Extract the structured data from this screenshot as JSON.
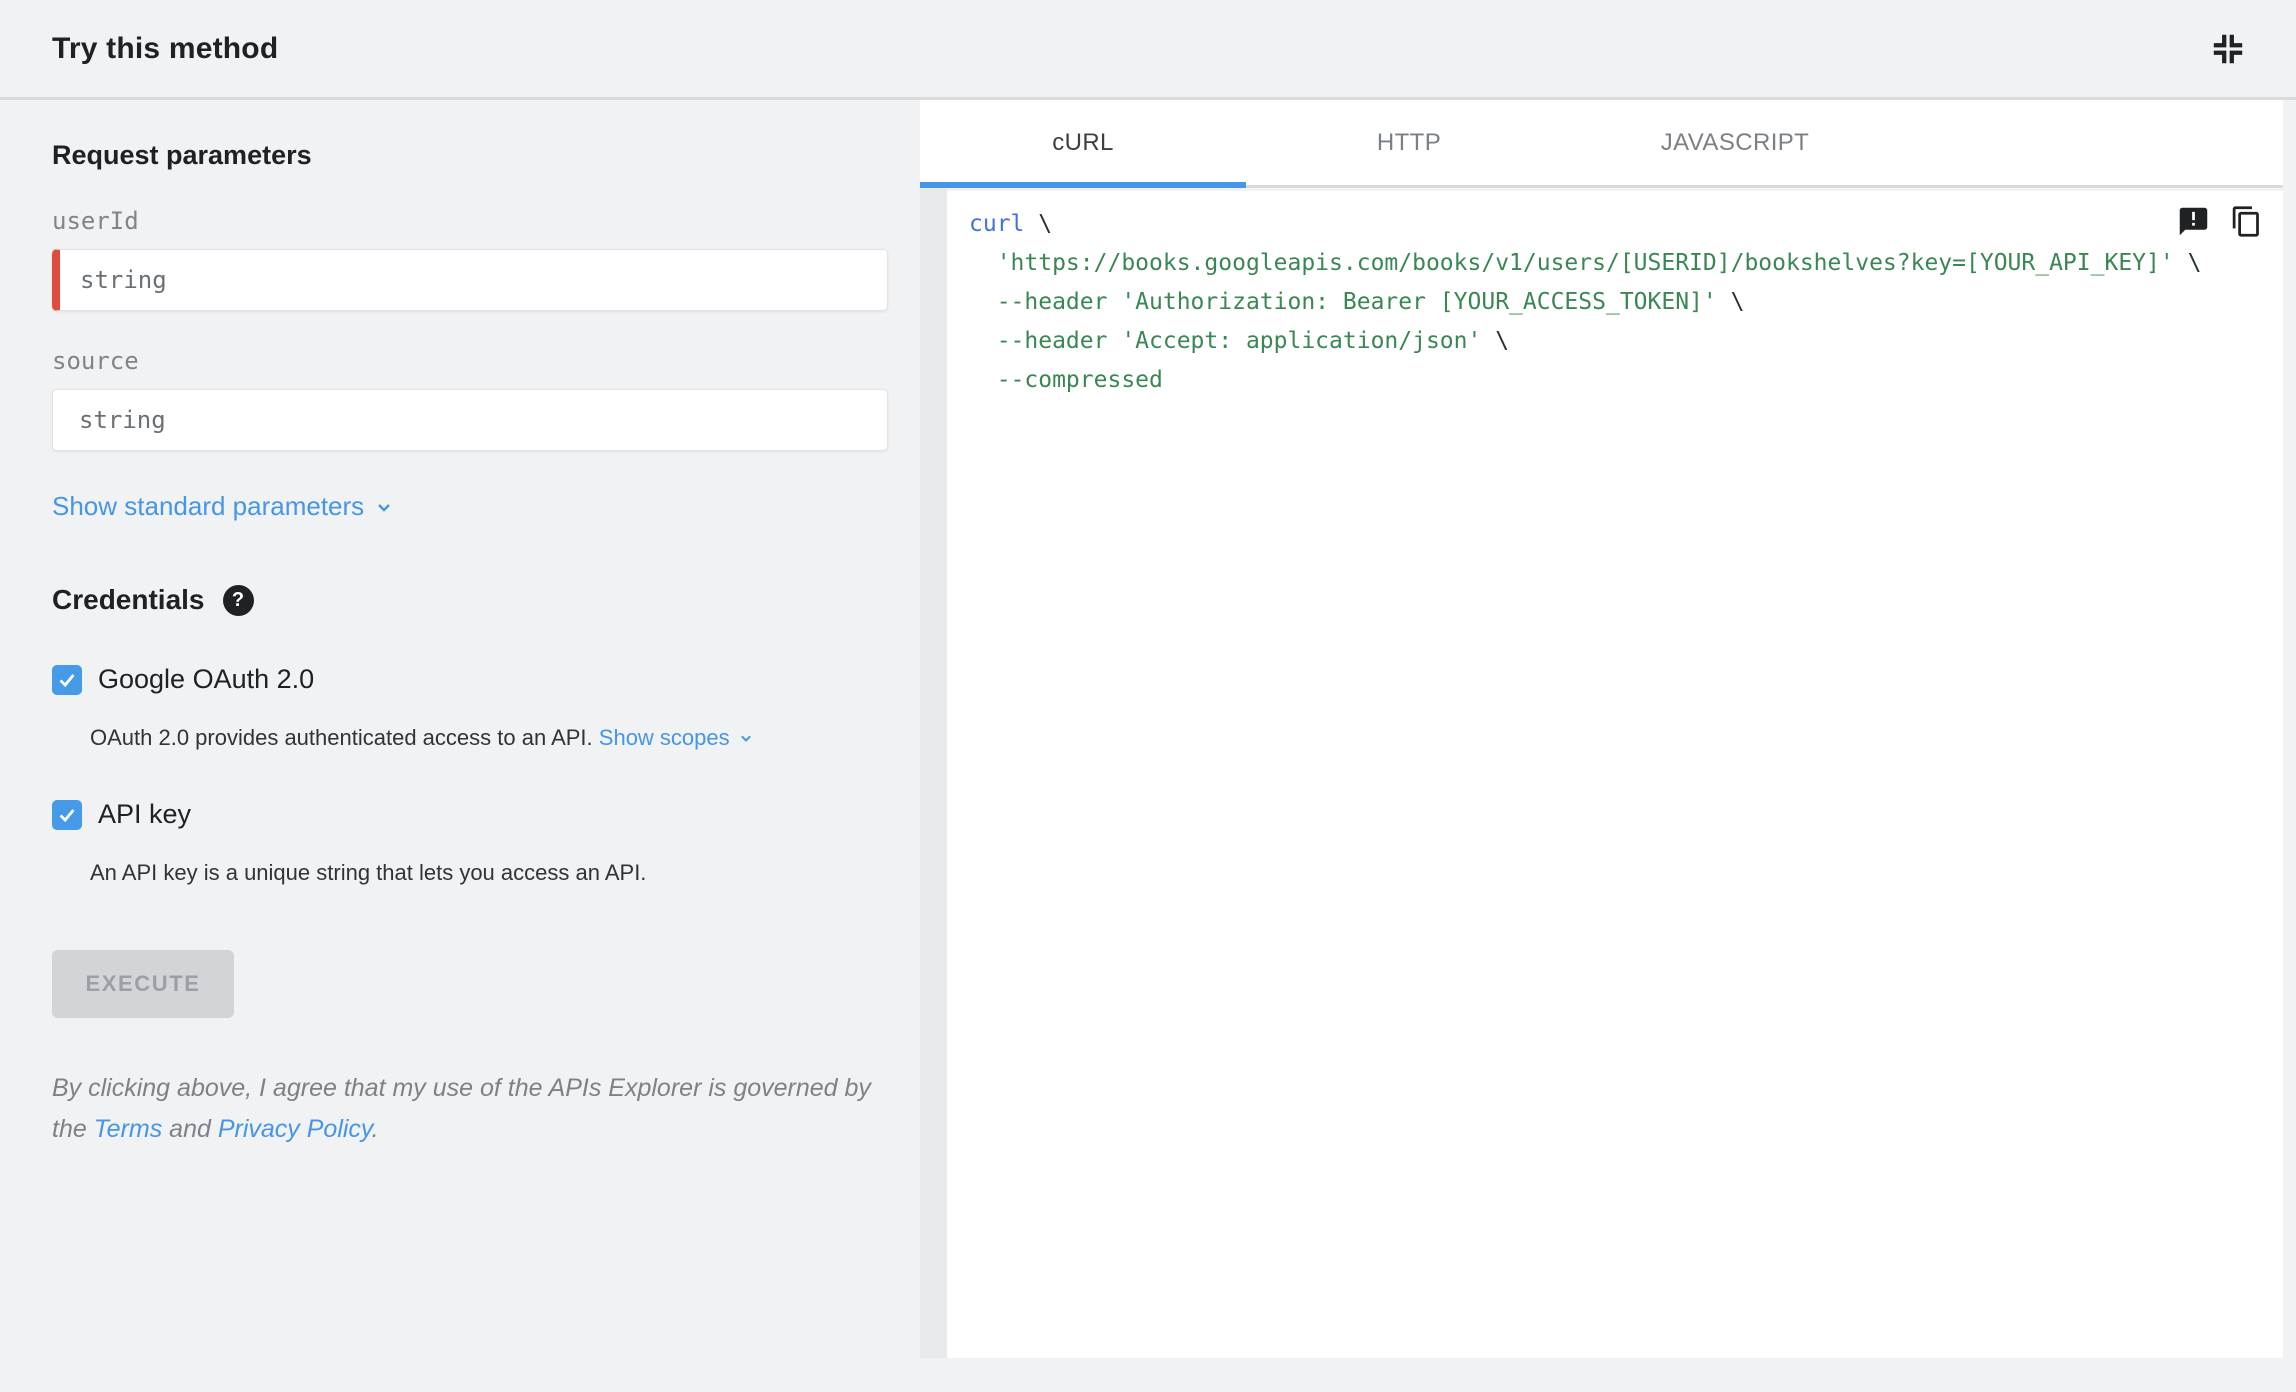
{
  "colors": {
    "link-blue": "#4795e6",
    "checkbox-blue": "#459be8",
    "tab-underline-blue": "#4795e6",
    "required-red": "#e04b3f",
    "code-keyword-blue": "#4272db",
    "code-string-green": "#3a8754"
  },
  "header": {
    "title": "Try this method"
  },
  "params": {
    "heading": "Request parameters",
    "userId": {
      "label": "userId",
      "placeholder": "string"
    },
    "source": {
      "label": "source",
      "placeholder": "string"
    },
    "show_standard_label": "Show standard parameters"
  },
  "credentials": {
    "heading": "Credentials",
    "oauth": {
      "label": "Google OAuth 2.0",
      "description": "OAuth 2.0 provides authenticated access to an API.",
      "link": "Show scopes"
    },
    "api_key": {
      "label": "API key",
      "description": "An API key is a unique string that lets you access an API."
    }
  },
  "execute_label": "EXECUTE",
  "legal": {
    "text_before": "By clicking above, I agree that my use of the APIs Explorer is governed by the ",
    "terms": "Terms",
    "text_middle": " and ",
    "privacy": "Privacy Policy",
    "text_after": "."
  },
  "tabs": {
    "curl": "cURL",
    "http": "HTTP",
    "javascript": "JAVASCRIPT"
  },
  "code": {
    "keyword": "curl",
    "line1_tail": " \\",
    "line2_str": "  'https://books.googleapis.com/books/v1/users/[USERID]/bookshelves?key=[YOUR_API_KEY]'",
    "line2_tail": " \\",
    "line3_str": "  --header 'Authorization: Bearer [YOUR_ACCESS_TOKEN]'",
    "line3_tail": " \\",
    "line4_str": "  --header 'Accept: application/json'",
    "line4_tail": " \\",
    "line5_str": "  --compressed"
  }
}
